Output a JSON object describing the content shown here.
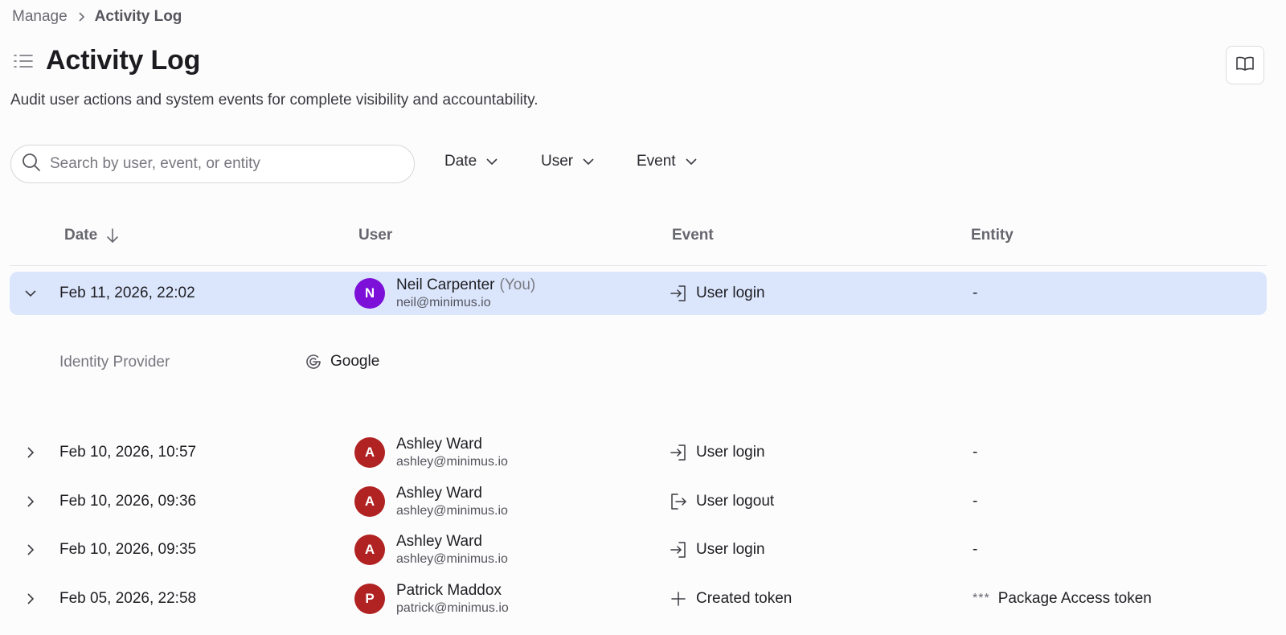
{
  "breadcrumb": {
    "parent": "Manage",
    "current": "Activity Log"
  },
  "page": {
    "title": "Activity Log",
    "subtitle": "Audit user actions and system events for complete visibility and accountability."
  },
  "search": {
    "placeholder": "Search by user, event, or entity"
  },
  "filters": {
    "date": "Date",
    "user": "User",
    "event": "Event"
  },
  "table": {
    "headers": {
      "date": "Date",
      "user": "User",
      "event": "Event",
      "entity": "Entity"
    },
    "rows": [
      {
        "date": "Feb 11, 2026, 22:02",
        "avatar_letter": "N",
        "avatar_color": "#7c10d9",
        "user_name": "Neil Carpenter",
        "user_suffix": "(You)",
        "user_email": "neil@minimus.io",
        "event_icon": "login-icon",
        "event": "User login",
        "entity": "-"
      },
      {
        "date": "Feb 10, 2026, 10:57",
        "avatar_letter": "A",
        "avatar_color": "#b12222",
        "user_name": "Ashley Ward",
        "user_email": "ashley@minimus.io",
        "event_icon": "login-icon",
        "event": "User login",
        "entity": "-"
      },
      {
        "date": "Feb 10, 2026, 09:36",
        "avatar_letter": "A",
        "avatar_color": "#b12222",
        "user_name": "Ashley Ward",
        "user_email": "ashley@minimus.io",
        "event_icon": "logout-icon",
        "event": "User logout",
        "entity": "-"
      },
      {
        "date": "Feb 10, 2026, 09:35",
        "avatar_letter": "A",
        "avatar_color": "#b12222",
        "user_name": "Ashley Ward",
        "user_email": "ashley@minimus.io",
        "event_icon": "login-icon",
        "event": "User login",
        "entity": "-"
      },
      {
        "date": "Feb 05, 2026, 22:58",
        "avatar_letter": "P",
        "avatar_color": "#b12222",
        "user_name": "Patrick Maddox",
        "user_email": "patrick@minimus.io",
        "event_icon": "plus-icon",
        "event": "Created token",
        "entity_prefix": "***",
        "entity": "Package Access token"
      }
    ],
    "expanded_detail": {
      "label": "Identity Provider",
      "icon": "google-icon",
      "value": "Google"
    }
  },
  "colors": {
    "selected_row": "#dbe6fd",
    "accent_purple": "#7c10d9",
    "avatar_red": "#b12222"
  }
}
